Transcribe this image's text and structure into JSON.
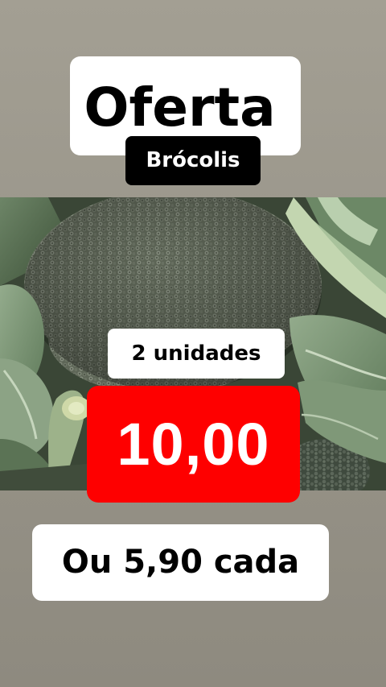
{
  "offer": {
    "title": "Oferta",
    "product": "Brócolis",
    "quantity": "2 unidades",
    "price": "10,00",
    "unit_price_note": "Ou 5,90 cada"
  },
  "colors": {
    "price_background": "#fe0000",
    "label_background": "#ffffff",
    "product_label_background": "#000000",
    "page_background": "#9b968a"
  },
  "image": {
    "subject": "broccoli-photo"
  }
}
